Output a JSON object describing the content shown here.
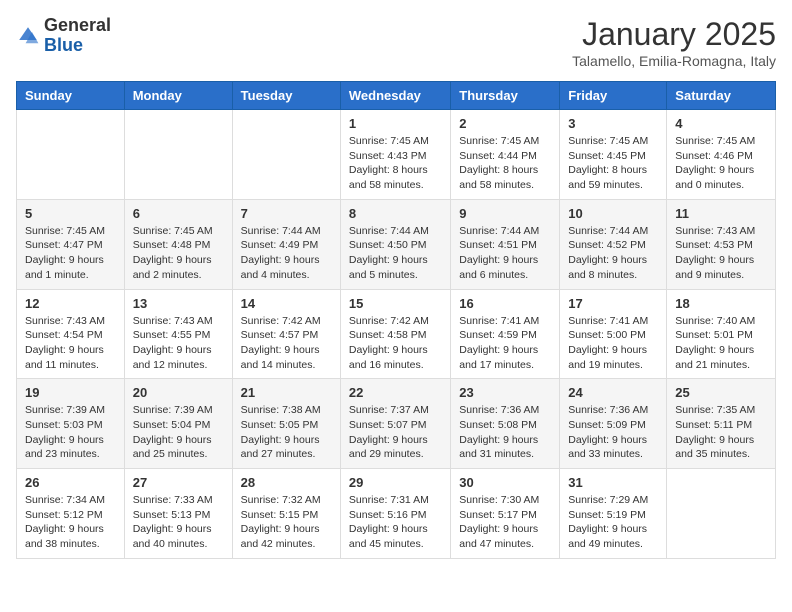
{
  "header": {
    "logo_general": "General",
    "logo_blue": "Blue",
    "month": "January 2025",
    "location": "Talamello, Emilia-Romagna, Italy"
  },
  "weekdays": [
    "Sunday",
    "Monday",
    "Tuesday",
    "Wednesday",
    "Thursday",
    "Friday",
    "Saturday"
  ],
  "weeks": [
    [
      {
        "day": "",
        "info": ""
      },
      {
        "day": "",
        "info": ""
      },
      {
        "day": "",
        "info": ""
      },
      {
        "day": "1",
        "info": "Sunrise: 7:45 AM\nSunset: 4:43 PM\nDaylight: 8 hours and 58 minutes."
      },
      {
        "day": "2",
        "info": "Sunrise: 7:45 AM\nSunset: 4:44 PM\nDaylight: 8 hours and 58 minutes."
      },
      {
        "day": "3",
        "info": "Sunrise: 7:45 AM\nSunset: 4:45 PM\nDaylight: 8 hours and 59 minutes."
      },
      {
        "day": "4",
        "info": "Sunrise: 7:45 AM\nSunset: 4:46 PM\nDaylight: 9 hours and 0 minutes."
      }
    ],
    [
      {
        "day": "5",
        "info": "Sunrise: 7:45 AM\nSunset: 4:47 PM\nDaylight: 9 hours and 1 minute."
      },
      {
        "day": "6",
        "info": "Sunrise: 7:45 AM\nSunset: 4:48 PM\nDaylight: 9 hours and 2 minutes."
      },
      {
        "day": "7",
        "info": "Sunrise: 7:44 AM\nSunset: 4:49 PM\nDaylight: 9 hours and 4 minutes."
      },
      {
        "day": "8",
        "info": "Sunrise: 7:44 AM\nSunset: 4:50 PM\nDaylight: 9 hours and 5 minutes."
      },
      {
        "day": "9",
        "info": "Sunrise: 7:44 AM\nSunset: 4:51 PM\nDaylight: 9 hours and 6 minutes."
      },
      {
        "day": "10",
        "info": "Sunrise: 7:44 AM\nSunset: 4:52 PM\nDaylight: 9 hours and 8 minutes."
      },
      {
        "day": "11",
        "info": "Sunrise: 7:43 AM\nSunset: 4:53 PM\nDaylight: 9 hours and 9 minutes."
      }
    ],
    [
      {
        "day": "12",
        "info": "Sunrise: 7:43 AM\nSunset: 4:54 PM\nDaylight: 9 hours and 11 minutes."
      },
      {
        "day": "13",
        "info": "Sunrise: 7:43 AM\nSunset: 4:55 PM\nDaylight: 9 hours and 12 minutes."
      },
      {
        "day": "14",
        "info": "Sunrise: 7:42 AM\nSunset: 4:57 PM\nDaylight: 9 hours and 14 minutes."
      },
      {
        "day": "15",
        "info": "Sunrise: 7:42 AM\nSunset: 4:58 PM\nDaylight: 9 hours and 16 minutes."
      },
      {
        "day": "16",
        "info": "Sunrise: 7:41 AM\nSunset: 4:59 PM\nDaylight: 9 hours and 17 minutes."
      },
      {
        "day": "17",
        "info": "Sunrise: 7:41 AM\nSunset: 5:00 PM\nDaylight: 9 hours and 19 minutes."
      },
      {
        "day": "18",
        "info": "Sunrise: 7:40 AM\nSunset: 5:01 PM\nDaylight: 9 hours and 21 minutes."
      }
    ],
    [
      {
        "day": "19",
        "info": "Sunrise: 7:39 AM\nSunset: 5:03 PM\nDaylight: 9 hours and 23 minutes."
      },
      {
        "day": "20",
        "info": "Sunrise: 7:39 AM\nSunset: 5:04 PM\nDaylight: 9 hours and 25 minutes."
      },
      {
        "day": "21",
        "info": "Sunrise: 7:38 AM\nSunset: 5:05 PM\nDaylight: 9 hours and 27 minutes."
      },
      {
        "day": "22",
        "info": "Sunrise: 7:37 AM\nSunset: 5:07 PM\nDaylight: 9 hours and 29 minutes."
      },
      {
        "day": "23",
        "info": "Sunrise: 7:36 AM\nSunset: 5:08 PM\nDaylight: 9 hours and 31 minutes."
      },
      {
        "day": "24",
        "info": "Sunrise: 7:36 AM\nSunset: 5:09 PM\nDaylight: 9 hours and 33 minutes."
      },
      {
        "day": "25",
        "info": "Sunrise: 7:35 AM\nSunset: 5:11 PM\nDaylight: 9 hours and 35 minutes."
      }
    ],
    [
      {
        "day": "26",
        "info": "Sunrise: 7:34 AM\nSunset: 5:12 PM\nDaylight: 9 hours and 38 minutes."
      },
      {
        "day": "27",
        "info": "Sunrise: 7:33 AM\nSunset: 5:13 PM\nDaylight: 9 hours and 40 minutes."
      },
      {
        "day": "28",
        "info": "Sunrise: 7:32 AM\nSunset: 5:15 PM\nDaylight: 9 hours and 42 minutes."
      },
      {
        "day": "29",
        "info": "Sunrise: 7:31 AM\nSunset: 5:16 PM\nDaylight: 9 hours and 45 minutes."
      },
      {
        "day": "30",
        "info": "Sunrise: 7:30 AM\nSunset: 5:17 PM\nDaylight: 9 hours and 47 minutes."
      },
      {
        "day": "31",
        "info": "Sunrise: 7:29 AM\nSunset: 5:19 PM\nDaylight: 9 hours and 49 minutes."
      },
      {
        "day": "",
        "info": ""
      }
    ]
  ]
}
